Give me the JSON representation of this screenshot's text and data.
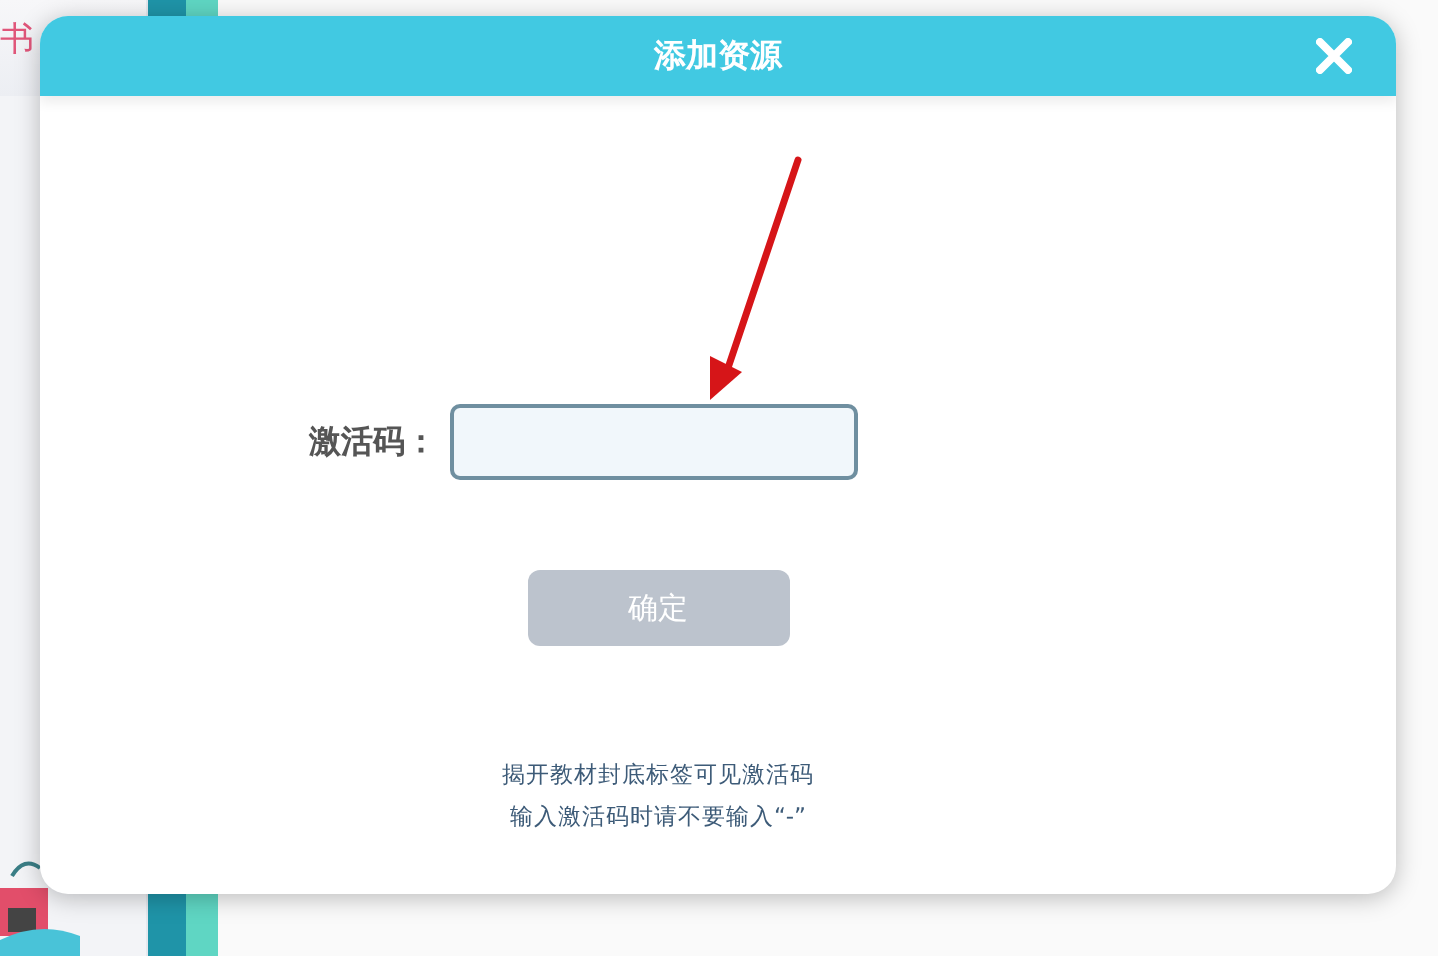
{
  "background": {
    "shelf_text": "书"
  },
  "dialog": {
    "title": "添加资源",
    "field": {
      "label": "激活码："
    },
    "button": {
      "label": "确定",
      "disabled": true
    },
    "hints": [
      "揭开教材封底标签可见激活码",
      "输入激活码时请不要输入“-”"
    ]
  }
}
